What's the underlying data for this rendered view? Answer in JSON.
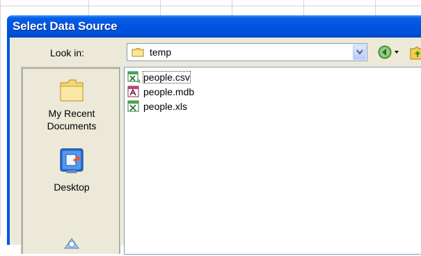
{
  "dialog": {
    "title": "Select Data Source",
    "look_in": {
      "label": "Look in:",
      "value": "temp",
      "folder_icon": "folder-icon"
    },
    "toolbar": {
      "back_icon": "back-arrow-icon",
      "dropdown_icon": "dropdown-arrow-icon",
      "up_icon": "up-folder-icon"
    },
    "places": [
      {
        "label_line1": "My Recent",
        "label_line2": "Documents",
        "icon": "recent-documents-icon"
      },
      {
        "label_line1": "Desktop",
        "label_line2": "",
        "icon": "desktop-icon"
      },
      {
        "label_line1": "",
        "label_line2": "",
        "icon": "my-documents-icon"
      }
    ],
    "files": [
      {
        "name": "people.csv",
        "icon": "excel-csv-icon"
      },
      {
        "name": "people.mdb",
        "icon": "access-database-icon"
      },
      {
        "name": "people.xls",
        "icon": "excel-workbook-icon"
      }
    ],
    "colors": {
      "titlebar": "#0054e3",
      "panel": "#ece9d8",
      "border": "#7f9db9"
    }
  }
}
